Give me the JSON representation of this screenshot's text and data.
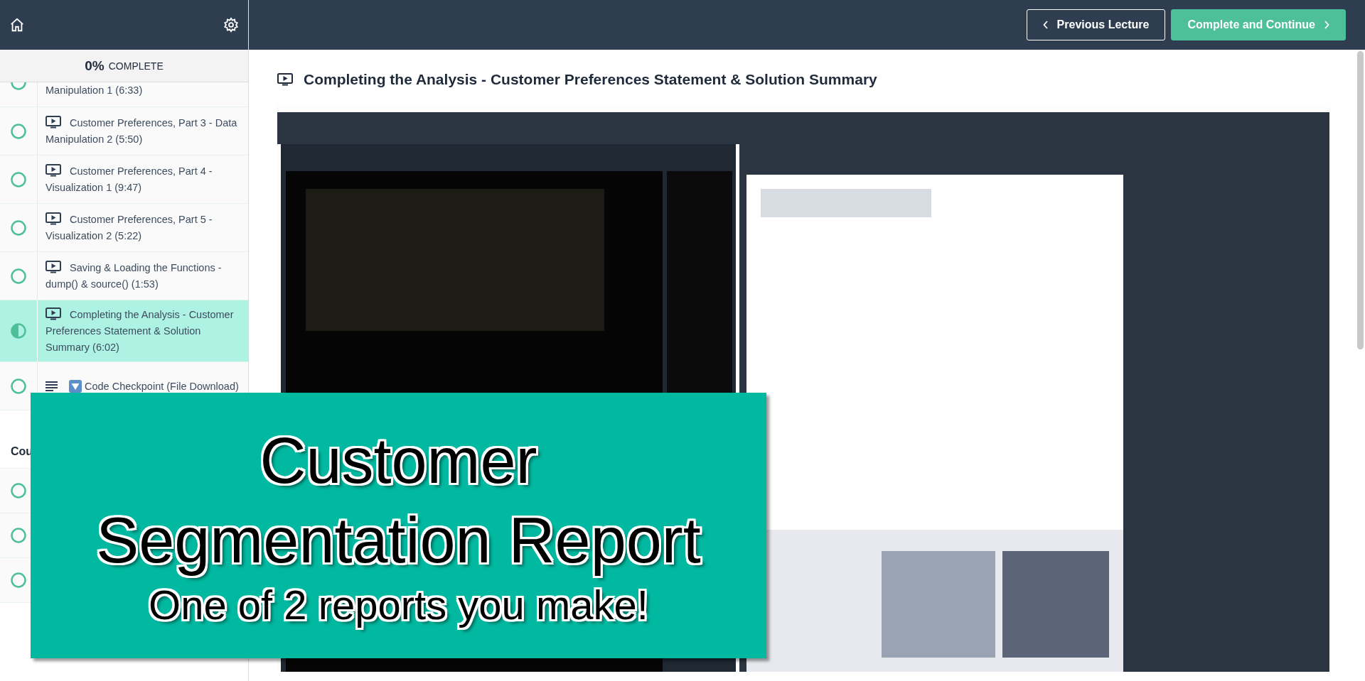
{
  "sidebar": {
    "progress": {
      "percent": "0%",
      "label": "COMPLETE"
    },
    "items": [
      {
        "kind": "lecture",
        "title": "Manipulation 1 (6:33)",
        "started": false,
        "selected": false,
        "partial": true
      },
      {
        "kind": "lecture",
        "title": "Customer Preferences, Part 3 - Data Manipulation 2 (5:50)",
        "started": false,
        "selected": false
      },
      {
        "kind": "lecture",
        "title": "Customer Preferences, Part 4 - Visualization 1 (9:47)",
        "started": false,
        "selected": false
      },
      {
        "kind": "lecture",
        "title": "Customer Preferences, Part 5 - Visualization 2 (5:22)",
        "started": false,
        "selected": false
      },
      {
        "kind": "lecture",
        "title": "Saving & Loading the Functions - dump() & source() (1:53)",
        "started": false,
        "selected": false
      },
      {
        "kind": "lecture",
        "title": "Completing the Analysis - Customer Preferences Statement & Solution Summary (6:02)",
        "started": true,
        "selected": true
      },
      {
        "kind": "download",
        "title": "Code Checkpoint (File Download)",
        "started": false,
        "selected": false
      }
    ],
    "section": {
      "heading": "Cou",
      "items": [
        {
          "started": false
        },
        {
          "started": false
        },
        {
          "started": false
        }
      ]
    }
  },
  "header": {
    "buttons": [
      {
        "kind": "previous",
        "label": "Previous Lecture"
      },
      {
        "kind": "next",
        "label": "Complete and Continue"
      }
    ]
  },
  "lecture": {
    "title": "Completing the Analysis - Customer Preferences Statement & Solution Summary"
  },
  "banner": {
    "lines": [
      "Customer",
      "Segmentation Report"
    ],
    "subtitle": "One of 2 reports you make!"
  }
}
